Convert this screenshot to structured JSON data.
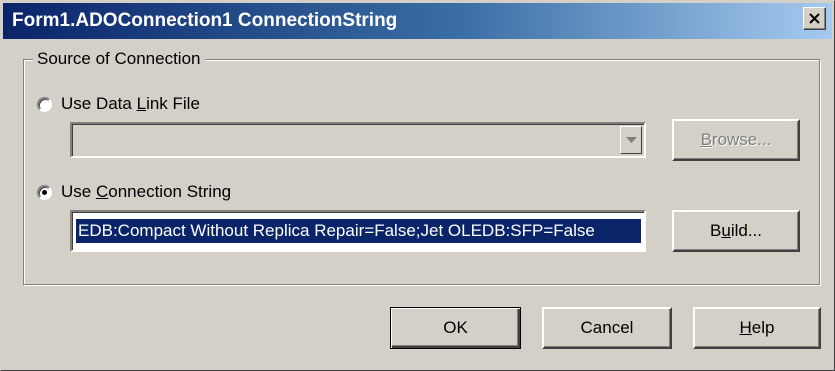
{
  "window": {
    "title": "Form1.ADOConnection1 ConnectionString"
  },
  "group": {
    "legend": "Source of Connection"
  },
  "options": {
    "data_link_file": {
      "label_pre": "Use Data ",
      "label_accel": "L",
      "label_post": "ink File",
      "selected": false
    },
    "connection_string": {
      "label_pre": "Use ",
      "label_accel": "C",
      "label_post": "onnection String",
      "selected": true
    }
  },
  "data_link_combo": {
    "value": "",
    "enabled": false
  },
  "browse_button": {
    "label_accel": "B",
    "label_post": "rowse...",
    "enabled": false
  },
  "connection_string_input": {
    "value": "EDB:Compact Without Replica Repair=False;Jet OLEDB:SFP=False"
  },
  "build_button": {
    "label_pre": "B",
    "label_accel": "u",
    "label_post": "ild..."
  },
  "footer": {
    "ok_label": "OK",
    "cancel_label": "Cancel",
    "help_accel": "H",
    "help_post": "elp"
  },
  "icons": {
    "close": "close-icon",
    "combo_arrow": "chevron-down-icon"
  },
  "colors": {
    "titlebar_start": "#0a246a",
    "titlebar_end": "#a6caf0",
    "face": "#d4d0c8",
    "selection": "#0a246a"
  }
}
